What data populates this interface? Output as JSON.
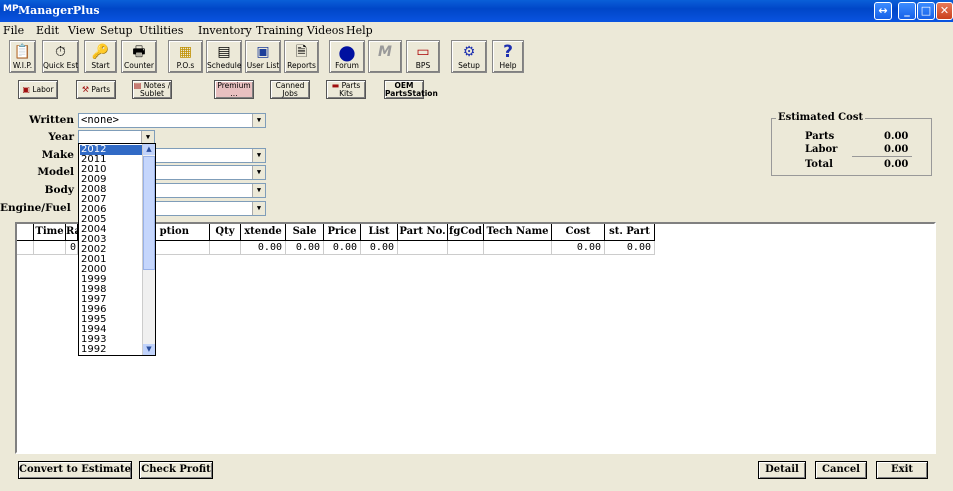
{
  "window": {
    "title": "ManagerPlus",
    "icon_text": "MP"
  },
  "menu": [
    "File",
    "Edit",
    "View",
    "Setup",
    "Utilities",
    "Inventory",
    "Training Videos",
    "Help"
  ],
  "toolbar": [
    {
      "label": "W.I.P.",
      "icon": "clipboard-icon",
      "glyph": "📋"
    },
    {
      "label": "Quick Est",
      "icon": "stopwatch-icon",
      "glyph": "⏱"
    },
    {
      "label": "Start",
      "icon": "keys-icon",
      "glyph": "🔑"
    },
    {
      "label": "Counter",
      "icon": "counter-icon",
      "glyph": "🖶"
    },
    {
      "label": "P.O.s",
      "icon": "purchase-order-icon",
      "glyph": "▦"
    },
    {
      "label": "Schedule",
      "icon": "schedule-icon",
      "glyph": "▤"
    },
    {
      "label": "User List",
      "icon": "user-list-icon",
      "glyph": "▣"
    },
    {
      "label": "Reports",
      "icon": "reports-icon",
      "glyph": "🗎"
    },
    {
      "label": "Forum",
      "icon": "forum-globe-icon",
      "glyph": "●"
    },
    {
      "label": "",
      "icon": "mp-logo-icon",
      "glyph": "M"
    },
    {
      "label": "BPS",
      "icon": "bps-icon",
      "glyph": "▭"
    },
    {
      "label": "Setup",
      "icon": "gears-icon",
      "glyph": "⚙"
    },
    {
      "label": "Help",
      "icon": "help-icon",
      "glyph": "?"
    }
  ],
  "subbar": [
    {
      "label": "Labor",
      "icon": "labor-icon"
    },
    {
      "label": "Parts",
      "icon": "parts-icon"
    },
    {
      "label": "Notes / Sublet",
      "icon": "notes-icon"
    },
    {
      "label": "Premium ...",
      "icon": "premium-icon"
    },
    {
      "label": "Canned Jobs",
      "icon": "canned-jobs-icon"
    },
    {
      "label": "Parts Kits",
      "icon": "parts-kits-icon"
    },
    {
      "label": "OEM PartsStation",
      "icon": "oem-icon"
    }
  ],
  "form": {
    "written_label": "Written",
    "written_value": "<none>",
    "year_label": "Year",
    "year_value": "",
    "make_label": "Make",
    "model_label": "Model",
    "body_label": "Body",
    "engine_label": "Engine/Fuel"
  },
  "estimated_cost": {
    "title": "Estimated Cost",
    "parts_label": "Parts",
    "parts_value": "0.00",
    "labor_label": "Labor",
    "labor_value": "0.00",
    "total_label": "Total",
    "total_value": "0.00"
  },
  "year_options": [
    "2012",
    "2011",
    "2010",
    "2009",
    "2008",
    "2007",
    "2006",
    "2005",
    "2004",
    "2003",
    "2002",
    "2001",
    "2000",
    "1999",
    "1998",
    "1997",
    "1996",
    "1995",
    "1994",
    "1993",
    "1992"
  ],
  "grid": {
    "headers": [
      "",
      "Time",
      "Ra",
      "ption",
      "Qty",
      "xtende",
      "Sale",
      "Price",
      "List",
      "Part No.",
      "fgCod",
      "Tech Name",
      "Cost",
      "st. Part"
    ],
    "row": [
      "",
      "",
      "0",
      "",
      "",
      "0.00",
      "0.00",
      "0.00",
      "0.00",
      "",
      "",
      "",
      "0.00",
      "0.00"
    ]
  },
  "buttons": {
    "convert": "Convert to Estimate",
    "check_profit": "Check Profit",
    "detail": "Detail",
    "cancel": "Cancel",
    "exit": "Exit"
  }
}
